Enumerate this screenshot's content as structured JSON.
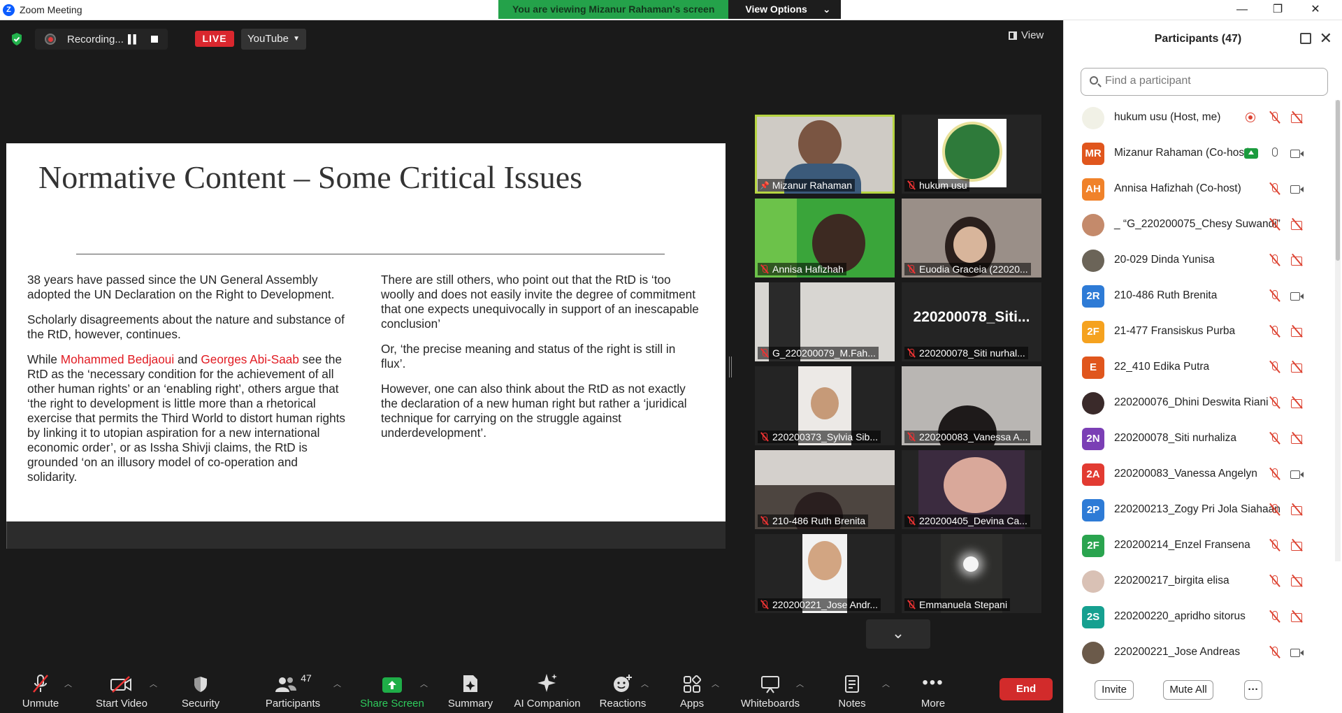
{
  "window": {
    "title": "Zoom Meeting",
    "app_logo": "Z"
  },
  "banner": {
    "viewing": "You are viewing Mizanur Rahaman's screen",
    "view_options": "View Options"
  },
  "topbar": {
    "recording_label": "Recording...",
    "live_label": "LIVE",
    "stream_target": "YouTube",
    "view_label": "View"
  },
  "slide": {
    "title": "Normative Content – Some Critical Issues",
    "left": {
      "p1": "38 years have passed since the UN General Assembly adopted the UN Declaration on the Right to Development.",
      "p2": "Scholarly disagreements about the nature and substance of the RtD, however, continues.",
      "p3_a": "While ",
      "p3_name1": "Mohammed Bedjaoui",
      "p3_b": " and ",
      "p3_name2": "Georges Abi-Saab",
      "p3_c": " see the RtD as the ‘necessary condition for the achievement of all other human rights’ or an ‘enabling right’, others argue that ‘the right to development is little more than a rhetorical exercise that permits the Third World to distort human rights by linking it to utopian aspiration for a new international economic order’, or as Issha Shivji claims, the RtD is grounded ‘on an illusory model of co-operation and solidarity."
    },
    "right": {
      "p1": "There are still others, who point out that the RtD is ‘too woolly and does not easily invite the degree of commitment that one expects unequivocally in support of an inescapable conclusion’",
      "p2": "Or, ‘the precise meaning and status of the right is still in flux’.",
      "p3": "However, one can also think about the RtD as not exactly the declaration of a new human right but rather a ‘juridical technique for carrying on the struggle against underdevelopment’."
    },
    "highlight_color": "#e11b22"
  },
  "gallery": {
    "tiles": [
      {
        "name": "Mizanur Rahaman"
      },
      {
        "name": "hukum usu"
      },
      {
        "name": "Annisa Hafizhah"
      },
      {
        "name": "Euodia Graceia (22020..."
      },
      {
        "name": "G_220200079_M.Fah..."
      },
      {
        "name": "220200078_Siti nurhal...",
        "display": "220200078_Siti..."
      },
      {
        "name": "220200373_Sylvia Sib..."
      },
      {
        "name": "220200083_Vanessa A..."
      },
      {
        "name": "210-486 Ruth Brenita"
      },
      {
        "name": "220200405_Devina Ca..."
      },
      {
        "name": "220200221_Jose Andr..."
      },
      {
        "name": "Emmanuela Stepani"
      }
    ]
  },
  "toolbar": {
    "unmute": "Unmute",
    "start_video": "Start Video",
    "security": "Security",
    "participants": "Participants",
    "participants_count": "47",
    "share_screen": "Share Screen",
    "summary": "Summary",
    "ai_companion": "AI Companion",
    "reactions": "Reactions",
    "apps": "Apps",
    "whiteboards": "Whiteboards",
    "notes": "Notes",
    "more": "More",
    "end": "End"
  },
  "panel": {
    "title": "Participants (47)",
    "search_placeholder": "Find a participant",
    "participants": [
      {
        "name": "hukum usu (Host, me)",
        "avatar": "",
        "color": "#f1f1e6"
      },
      {
        "name": "Mizanur Rahaman (Co-host)",
        "avatar": "MR",
        "color": "#e0561d"
      },
      {
        "name": "Annisa Hafizhah (Co-host)",
        "avatar": "AH",
        "color": "#f0822a"
      },
      {
        "name": "_ “G_220200075_Chesy Suwandi”",
        "avatar": "",
        "color": "#c48a6b"
      },
      {
        "name": "20-029 Dinda Yunisa",
        "avatar": "",
        "color": "#6b6458"
      },
      {
        "name": "210-486 Ruth Brenita",
        "avatar": "2R",
        "color": "#2e7bd6"
      },
      {
        "name": "21-477 Fransiskus Purba",
        "avatar": "2F",
        "color": "#f5a21f"
      },
      {
        "name": "22_410 Edika Putra",
        "avatar": "E",
        "color": "#e0561d"
      },
      {
        "name": "220200076_Dhini Deswita Riani",
        "avatar": "",
        "color": "#3a2a2a"
      },
      {
        "name": "220200078_Siti nurhaliza",
        "avatar": "2N",
        "color": "#7b3fb5"
      },
      {
        "name": "220200083_Vanessa Angelyn",
        "avatar": "2A",
        "color": "#e23b32"
      },
      {
        "name": "220200213_Zogy Pri Jola Siahaan",
        "avatar": "2P",
        "color": "#2e7bd6"
      },
      {
        "name": "220200214_Enzel Fransena",
        "avatar": "2F",
        "color": "#2aa44f"
      },
      {
        "name": "220200217_birgita elisa",
        "avatar": "",
        "color": "#d9c1b5"
      },
      {
        "name": "220200220_apridho sitorus",
        "avatar": "2S",
        "color": "#16a090"
      },
      {
        "name": "220200221_Jose Andreas",
        "avatar": "",
        "color": "#6b5a4a"
      }
    ],
    "invite": "Invite",
    "mute_all": "Mute All",
    "more": "···"
  }
}
